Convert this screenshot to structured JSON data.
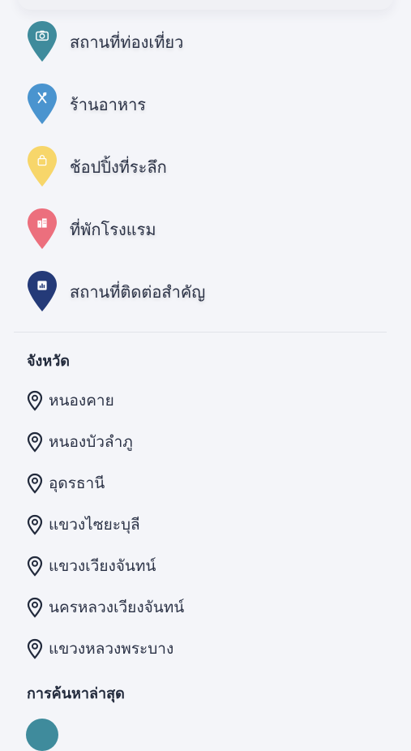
{
  "categories": [
    {
      "label": "สถานที่ท่องเที่ยว",
      "icon": "camera-icon",
      "color": "#3f8b9c"
    },
    {
      "label": "ร้านอาหาร",
      "icon": "utensils-icon",
      "color": "#4a94cf"
    },
    {
      "label": "ช้อปปิ้งที่ระลึก",
      "icon": "shopping-bag-icon",
      "color": "#f7d66a"
    },
    {
      "label": "ที่พักโรงแรม",
      "icon": "hotel-icon",
      "color": "#ec6f7d"
    },
    {
      "label": "สถานที่ติดต่อสำคัญ",
      "icon": "chart-icon",
      "color": "#243a78"
    }
  ],
  "province_section": {
    "title": "จังหวัด",
    "items": [
      {
        "label": "หนองคาย",
        "icon": "map-pin-icon"
      },
      {
        "label": "หนองบัวลำภู",
        "icon": "map-pin-icon"
      },
      {
        "label": "อุดรธานี",
        "icon": "map-pin-icon"
      },
      {
        "label": "แขวงไซยะบุลี",
        "icon": "map-pin-icon"
      },
      {
        "label": "แขวงเวียงจันทน์",
        "icon": "map-pin-icon"
      },
      {
        "label": "นครหลวงเวียงจันทน์",
        "icon": "map-pin-icon"
      },
      {
        "label": "แขวงหลวงพระบาง",
        "icon": "map-pin-icon"
      }
    ]
  },
  "recent_section": {
    "title": "การค้นหาล่าสุด"
  }
}
